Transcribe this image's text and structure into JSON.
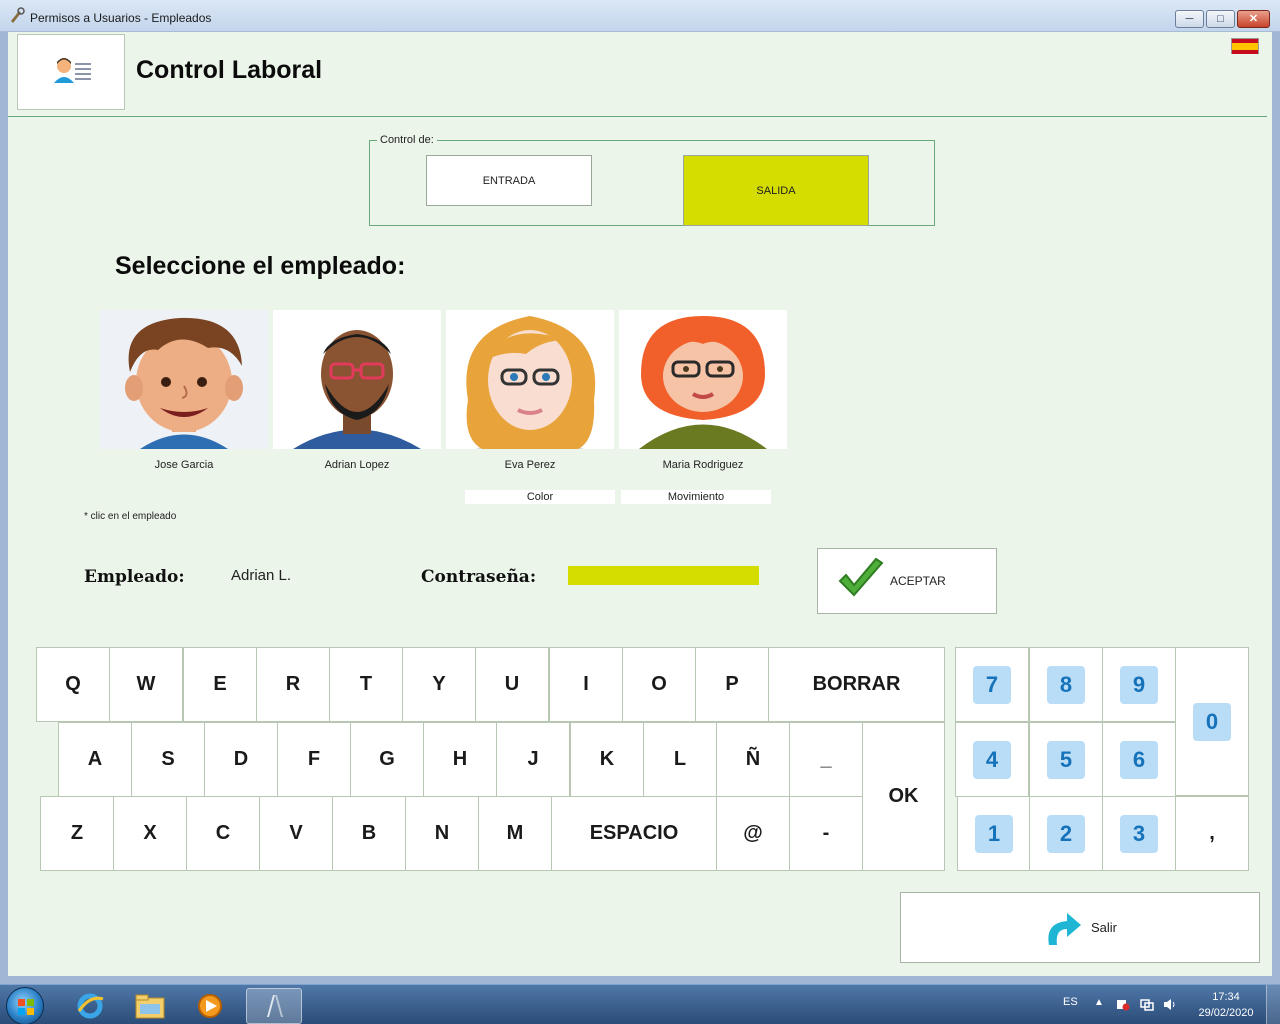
{
  "window": {
    "title": "Permisos a Usuarios - Empleados",
    "minimize": "─",
    "maximize": "□",
    "close": "✕"
  },
  "header": {
    "title": "Control Laboral",
    "language_flag": "spain-flag-icon"
  },
  "control": {
    "legend": "Control de:",
    "entrada_label": "ENTRADA",
    "salida_label": "SALIDA",
    "selected": "SALIDA",
    "highlight_color": "#d5dc00"
  },
  "select_title": "Seleccione el empleado:",
  "employees": [
    {
      "name": "Jose Garcia"
    },
    {
      "name": "Adrian Lopez"
    },
    {
      "name": "Eva Perez"
    },
    {
      "name": "Maria Rodriguez"
    }
  ],
  "options": {
    "color": "Color",
    "movimiento": "Movimiento"
  },
  "hint": "* clic en el empleado",
  "form": {
    "empleado_label": "Empleado:",
    "empleado_value": "Adrian L.",
    "password_label": "Contraseña:",
    "password_value": "",
    "accept_label": "ACEPTAR"
  },
  "keyboard": {
    "row1": [
      "Q",
      "W",
      "E",
      "R",
      "T",
      "Y",
      "U",
      "I",
      "O",
      "P"
    ],
    "borrar": "BORRAR",
    "row2": [
      "A",
      "S",
      "D",
      "F",
      "G",
      "H",
      "J",
      "K",
      "L",
      "Ñ",
      "_"
    ],
    "ok": "OK",
    "row3": [
      "Z",
      "X",
      "C",
      "V",
      "B",
      "N",
      "M"
    ],
    "espacio": "ESPACIO",
    "at": "@",
    "dash": "-"
  },
  "numpad": {
    "keys": [
      "7",
      "8",
      "9",
      "0",
      "4",
      "5",
      "6",
      "1",
      "2",
      "3",
      ","
    ],
    "chip_color": "#b9dcf7",
    "digit_color": "#1672b9"
  },
  "exit_label": "Salir",
  "taskbar": {
    "items": [
      "internet-explorer-icon",
      "file-explorer-icon",
      "media-player-icon",
      "app-window-icon"
    ],
    "language": "ES",
    "time": "17:34",
    "date": "29/02/2020"
  }
}
